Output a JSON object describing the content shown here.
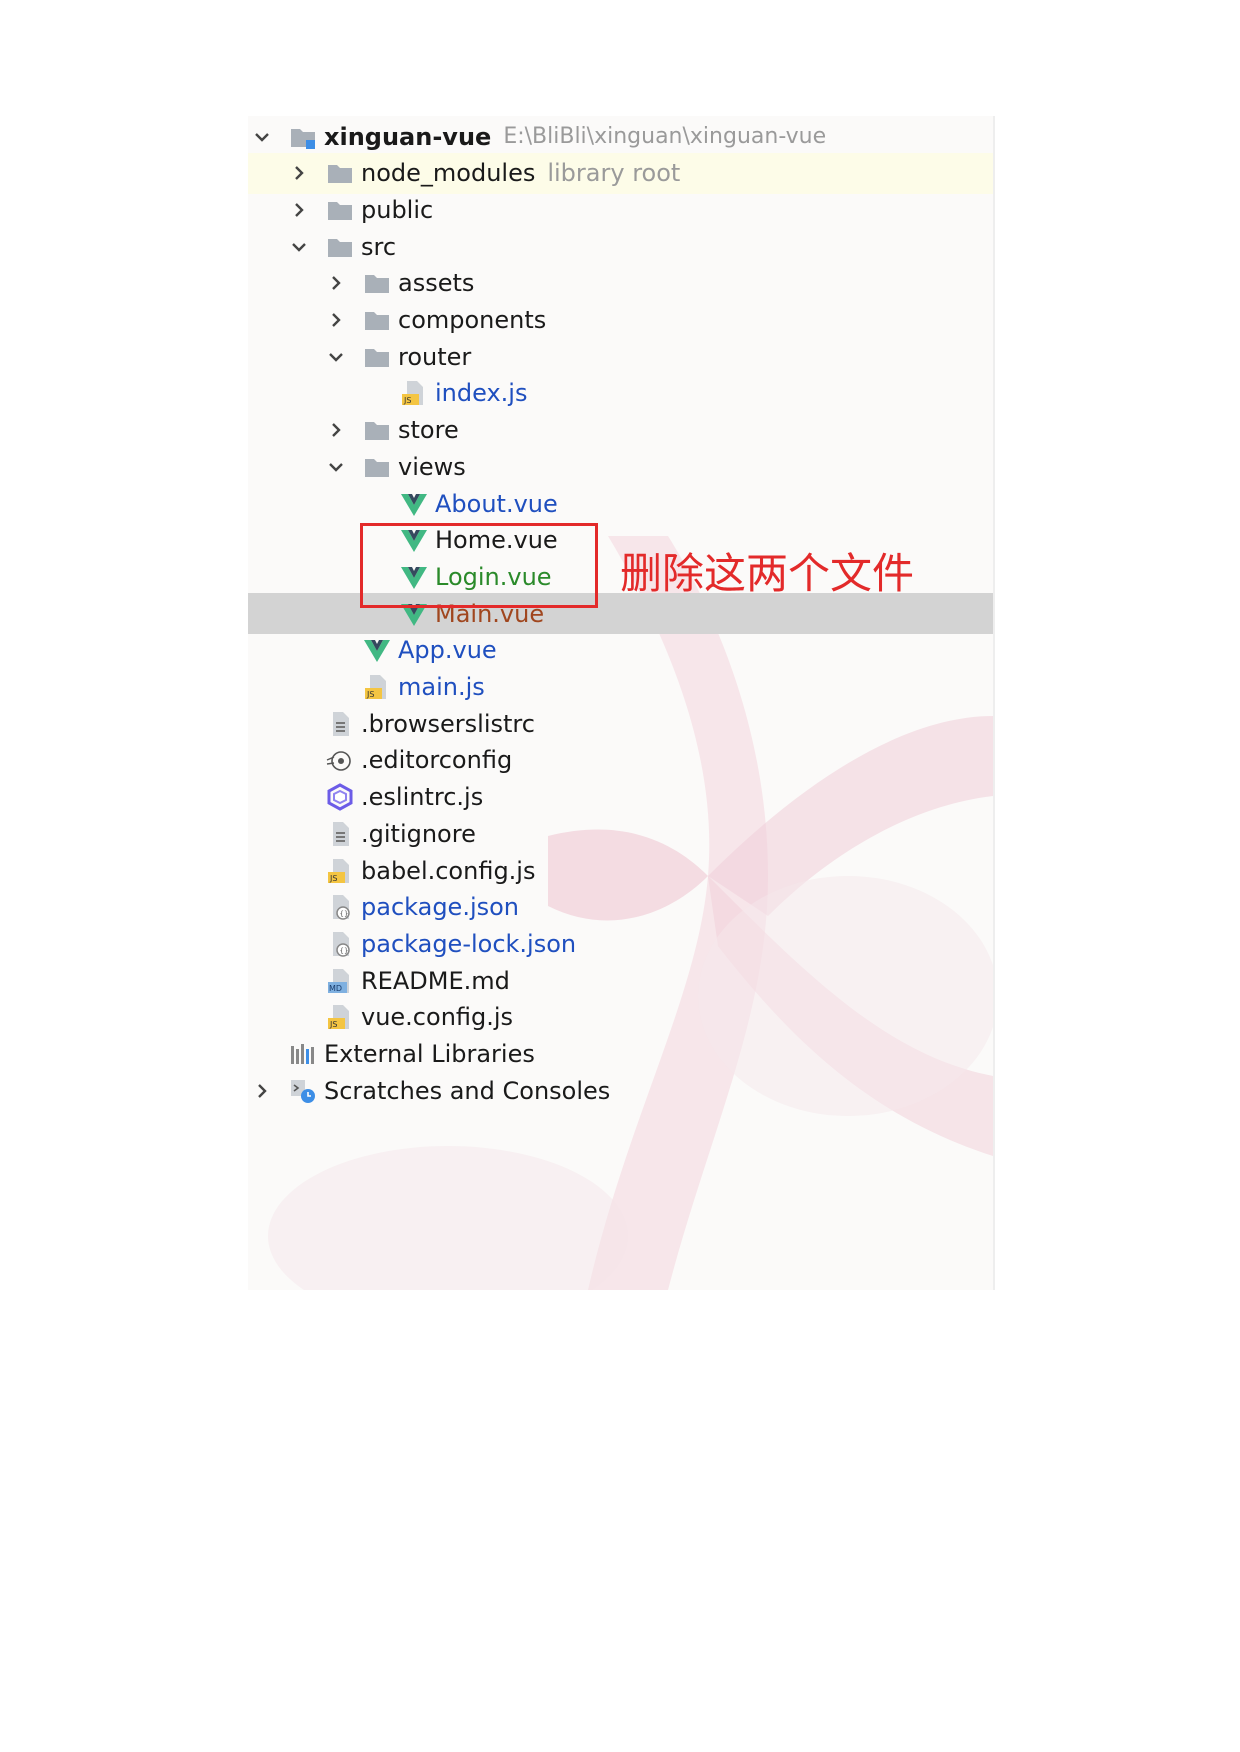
{
  "tree": [
    {
      "name": "xinguan-vue",
      "extra": "E:\\BliBli\\xinguan\\xinguan-vue",
      "depth": 0,
      "arrow": "down",
      "icon": "module-folder-icon",
      "style": "bold",
      "highlight": ""
    },
    {
      "name": "node_modules",
      "extra": "library root",
      "depth": 1,
      "arrow": "right",
      "icon": "folder-icon",
      "style": "",
      "highlight": "yellow"
    },
    {
      "name": "public",
      "extra": "",
      "depth": 1,
      "arrow": "right",
      "icon": "folder-icon",
      "style": "",
      "highlight": ""
    },
    {
      "name": "src",
      "extra": "",
      "depth": 1,
      "arrow": "down",
      "icon": "folder-icon",
      "style": "",
      "highlight": ""
    },
    {
      "name": "assets",
      "extra": "",
      "depth": 2,
      "arrow": "right",
      "icon": "folder-icon",
      "style": "",
      "highlight": ""
    },
    {
      "name": "components",
      "extra": "",
      "depth": 2,
      "arrow": "right",
      "icon": "folder-icon",
      "style": "",
      "highlight": ""
    },
    {
      "name": "router",
      "extra": "",
      "depth": 2,
      "arrow": "down",
      "icon": "folder-icon",
      "style": "",
      "highlight": ""
    },
    {
      "name": "index.js",
      "extra": "",
      "depth": 3,
      "arrow": "",
      "icon": "js-file-icon",
      "style": "blue",
      "highlight": ""
    },
    {
      "name": "store",
      "extra": "",
      "depth": 2,
      "arrow": "right",
      "icon": "folder-icon",
      "style": "",
      "highlight": ""
    },
    {
      "name": "views",
      "extra": "",
      "depth": 2,
      "arrow": "down",
      "icon": "folder-icon",
      "style": "",
      "highlight": ""
    },
    {
      "name": "About.vue",
      "extra": "",
      "depth": 3,
      "arrow": "",
      "icon": "vue-file-icon",
      "style": "blue",
      "highlight": ""
    },
    {
      "name": "Home.vue",
      "extra": "",
      "depth": 3,
      "arrow": "",
      "icon": "vue-file-icon",
      "style": "",
      "highlight": ""
    },
    {
      "name": "Login.vue",
      "extra": "",
      "depth": 3,
      "arrow": "",
      "icon": "vue-file-icon",
      "style": "green",
      "highlight": ""
    },
    {
      "name": "Main.vue",
      "extra": "",
      "depth": 3,
      "arrow": "",
      "icon": "vue-file-icon",
      "style": "brown",
      "highlight": "grey"
    },
    {
      "name": "App.vue",
      "extra": "",
      "depth": 2,
      "arrow": "",
      "icon": "vue-file-icon",
      "style": "blue",
      "highlight": ""
    },
    {
      "name": "main.js",
      "extra": "",
      "depth": 2,
      "arrow": "",
      "icon": "js-file-icon",
      "style": "blue",
      "highlight": ""
    },
    {
      "name": ".browserslistrc",
      "extra": "",
      "depth": 1,
      "arrow": "",
      "icon": "text-file-icon",
      "style": "",
      "highlight": ""
    },
    {
      "name": ".editorconfig",
      "extra": "",
      "depth": 1,
      "arrow": "",
      "icon": "editorconfig-icon",
      "style": "",
      "highlight": ""
    },
    {
      "name": ".eslintrc.js",
      "extra": "",
      "depth": 1,
      "arrow": "",
      "icon": "eslint-icon",
      "style": "",
      "highlight": ""
    },
    {
      "name": ".gitignore",
      "extra": "",
      "depth": 1,
      "arrow": "",
      "icon": "text-file-icon",
      "style": "",
      "highlight": ""
    },
    {
      "name": "babel.config.js",
      "extra": "",
      "depth": 1,
      "arrow": "",
      "icon": "js-file-icon",
      "style": "",
      "highlight": ""
    },
    {
      "name": "package.json",
      "extra": "",
      "depth": 1,
      "arrow": "",
      "icon": "json-file-icon",
      "style": "blue",
      "highlight": ""
    },
    {
      "name": "package-lock.json",
      "extra": "",
      "depth": 1,
      "arrow": "",
      "icon": "json-file-icon",
      "style": "blue",
      "highlight": ""
    },
    {
      "name": "README.md",
      "extra": "",
      "depth": 1,
      "arrow": "",
      "icon": "md-file-icon",
      "style": "",
      "highlight": ""
    },
    {
      "name": "vue.config.js",
      "extra": "",
      "depth": 1,
      "arrow": "",
      "icon": "js-file-icon",
      "style": "",
      "highlight": ""
    },
    {
      "name": "External Libraries",
      "extra": "",
      "depth": 0,
      "arrow": "none",
      "icon": "libraries-icon",
      "style": "",
      "highlight": ""
    },
    {
      "name": "Scratches and Consoles",
      "extra": "",
      "depth": 0,
      "arrow": "right",
      "icon": "scratches-icon",
      "style": "",
      "highlight": ""
    }
  ],
  "annotation": {
    "text": "删除这两个文件",
    "color": "#e32a2a"
  },
  "colors": {
    "folder": "#a9b0b8",
    "vue_green": "#41b883",
    "vue_dark": "#35495e",
    "js_yellow": "#f4c542",
    "file_blue": "#1f4fbf"
  }
}
